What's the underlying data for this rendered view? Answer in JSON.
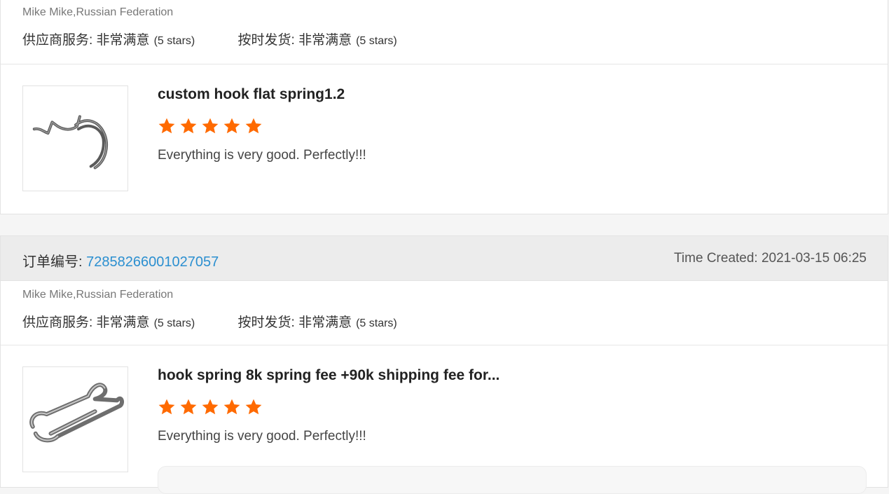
{
  "theme": {
    "accent": "#2b8fd0",
    "star_color": "#ff6a00"
  },
  "reviews": [
    {
      "buyer": "Mike Mike,Russian Federation",
      "supplier_service_label": "供应商服务: 非常满意",
      "supplier_service_stars": "(5 stars)",
      "ontime_label": "按时发货: 非常满意",
      "ontime_stars": "(5 stars)",
      "product_title": "custom hook flat spring1.2",
      "rating": 5,
      "review_text": "Everything is very good. Perfectly!!!",
      "product_icon": "bent-wire-hook"
    },
    {
      "order_label": "订单编号:",
      "order_number": "72858266001027057",
      "time_created": "Time Created: 2021-03-15 06:25",
      "buyer": "Mike Mike,Russian Federation",
      "supplier_service_label": "供应商服务: 非常满意",
      "supplier_service_stars": "(5 stars)",
      "ontime_label": "按时发货: 非常满意",
      "ontime_stars": "(5 stars)",
      "product_title": "hook spring 8k spring fee +90k shipping fee for...",
      "rating": 5,
      "review_text": "Everything is very good. Perfectly!!!",
      "product_icon": "double-loop-wire-spring"
    }
  ]
}
